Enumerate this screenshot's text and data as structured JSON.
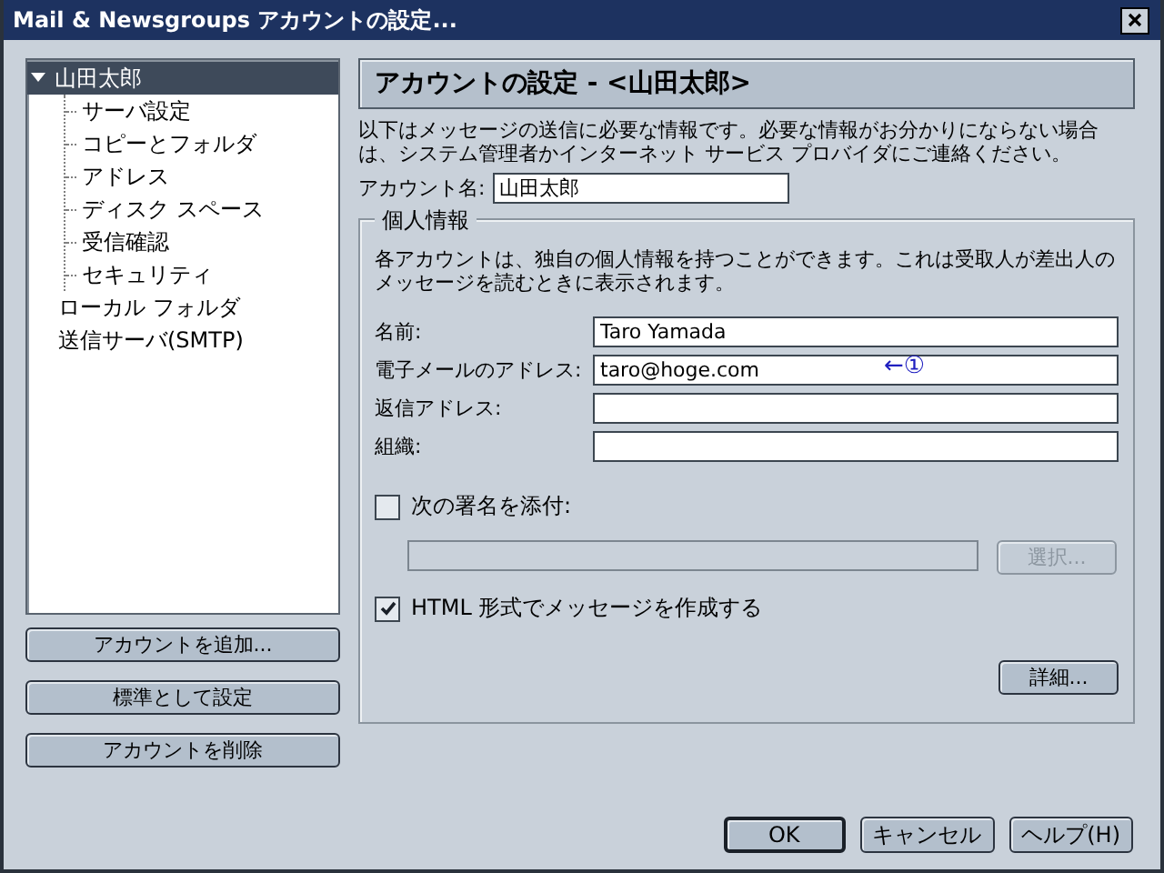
{
  "window": {
    "title": "Mail & Newsgroups アカウントの設定..."
  },
  "tree": [
    {
      "label": "山田太郎",
      "selected": true,
      "expanded": true,
      "children": [
        {
          "label": "サーバ設定",
          "selected": false
        },
        {
          "label": "コピーとフォルダ",
          "selected": false
        },
        {
          "label": "アドレス",
          "selected": false
        },
        {
          "label": "ディスク スペース",
          "selected": false
        },
        {
          "label": "受信確認",
          "selected": false
        },
        {
          "label": "セキュリティ",
          "selected": false
        }
      ]
    },
    {
      "label": "ローカル フォルダ",
      "selected": false
    },
    {
      "label": "送信サーバ(SMTP)",
      "selected": false
    }
  ],
  "account_buttons": [
    {
      "label": "アカウントを追加..."
    },
    {
      "label": "標準として設定"
    },
    {
      "label": "アカウントを削除"
    }
  ],
  "panel": {
    "title": "アカウントの設定 - <山田太郎>",
    "description": "以下はメッセージの送信に必要な情報です。必要な情報がお分かりにならない場合は、システム管理者かインターネット サービス プロバイダにご連絡ください。",
    "account_name": {
      "label": "アカウント名:",
      "value": "山田太郎"
    },
    "group": {
      "legend": "個人情報",
      "description": "各アカウントは、独自の個人情報を持つことができます。これは受取人が差出人のメッセージを読むときに表示されます。",
      "fields": [
        {
          "label": "名前:",
          "value": "Taro Yamada"
        },
        {
          "label": "電子メールのアドレス:",
          "value": "taro@hoge.com",
          "annotation": "←①"
        },
        {
          "label": "返信アドレス:"
        },
        {
          "label": "組織:"
        }
      ],
      "signature": {
        "label": "次の署名を添付:",
        "checked": false
      },
      "signature_path": {
        "disabled": true
      },
      "choose_button": {
        "label": "選択...",
        "disabled": true
      },
      "html_compose": {
        "label": "HTML 形式でメッセージを作成する",
        "checked": true
      },
      "advanced_button": {
        "label": "詳細..."
      }
    }
  },
  "dialog_buttons": [
    {
      "label": "OK",
      "default": true
    },
    {
      "label": "キャンセル",
      "default": false
    },
    {
      "label": "ヘルプ(H)",
      "default": false
    }
  ]
}
